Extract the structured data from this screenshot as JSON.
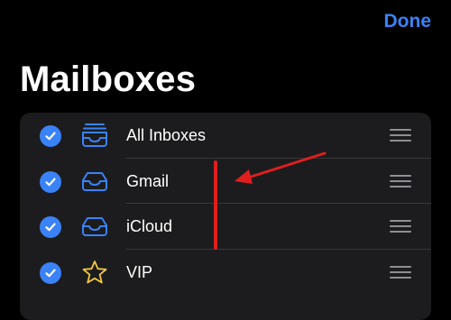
{
  "header": {
    "done_label": "Done",
    "title": "Mailboxes"
  },
  "mailboxes": [
    {
      "label": "All Inboxes",
      "checked": true,
      "icon": "tray-stack-icon"
    },
    {
      "label": "Gmail",
      "checked": true,
      "icon": "tray-icon"
    },
    {
      "label": "iCloud",
      "checked": true,
      "icon": "tray-icon"
    },
    {
      "label": "VIP",
      "checked": true,
      "icon": "star-icon"
    }
  ],
  "colors": {
    "accent": "#3a82f7",
    "background": "#000000",
    "list_background": "#1c1c1e",
    "separator": "#38383a",
    "vip_star": "#f5c842",
    "annotation": "#e01e1e"
  }
}
